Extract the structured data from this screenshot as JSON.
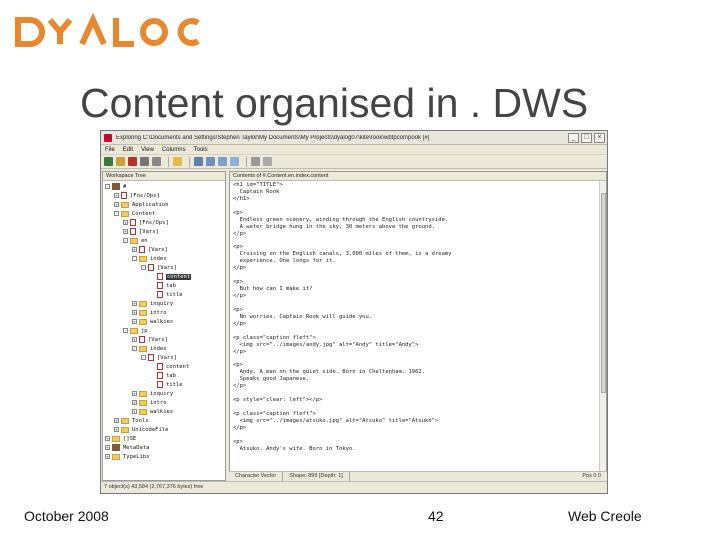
{
  "logo": {
    "text": "DYALOC",
    "color": "#e8872b"
  },
  "slide": {
    "title": "Content organised in . DWS"
  },
  "footer": {
    "date": "October 2008",
    "page": "42",
    "product": "Web Creole"
  },
  "window": {
    "title": "Exploring C:\\Documents and Settings\\Stephen Taylor\\My Documents\\My Projects\\dyalog07\\kite\\rook\\wbtpcon\\pook [#]",
    "menu": [
      "File",
      "Edit",
      "View",
      "Columns",
      "Tools"
    ],
    "left_pane_title": "Workspace Tree",
    "right_pane_title": "Contents of #.Content.en.index.content",
    "tree": [
      {
        "label": "#",
        "level": 0,
        "expand": "-",
        "icon": "ns"
      },
      {
        "label": "[Fns/Ops]",
        "level": 1,
        "expand": "+",
        "icon": "doc"
      },
      {
        "label": "Application",
        "level": 1,
        "expand": "+",
        "icon": "folder"
      },
      {
        "label": "Content",
        "level": 1,
        "expand": "-",
        "icon": "folder"
      },
      {
        "label": "[Fns/Ops]",
        "level": 2,
        "expand": "+",
        "icon": "doc"
      },
      {
        "label": "[Vars]",
        "level": 2,
        "expand": "+",
        "icon": "doc"
      },
      {
        "label": "en",
        "level": 2,
        "expand": "-",
        "icon": "folder"
      },
      {
        "label": "[Vars]",
        "level": 3,
        "expand": "+",
        "icon": "doc"
      },
      {
        "label": "index",
        "level": 3,
        "expand": "-",
        "icon": "folder"
      },
      {
        "label": "[Vars]",
        "level": 4,
        "expand": "-",
        "icon": "doc"
      },
      {
        "label": "content",
        "level": 5,
        "expand": "",
        "icon": "doc",
        "selected": true
      },
      {
        "label": "tab",
        "level": 5,
        "expand": "",
        "icon": "doc"
      },
      {
        "label": "title",
        "level": 5,
        "expand": "",
        "icon": "doc"
      },
      {
        "label": "inquiry",
        "level": 3,
        "expand": "+",
        "icon": "folder"
      },
      {
        "label": "intro",
        "level": 3,
        "expand": "+",
        "icon": "folder"
      },
      {
        "label": "walkies",
        "level": 3,
        "expand": "+",
        "icon": "folder"
      },
      {
        "label": "jp",
        "level": 2,
        "expand": "-",
        "icon": "folder"
      },
      {
        "label": "[Vars]",
        "level": 3,
        "expand": "+",
        "icon": "doc"
      },
      {
        "label": "index",
        "level": 3,
        "expand": "-",
        "icon": "folder"
      },
      {
        "label": "[Vars]",
        "level": 4,
        "expand": "-",
        "icon": "doc"
      },
      {
        "label": "content",
        "level": 5,
        "expand": "",
        "icon": "doc"
      },
      {
        "label": "tab",
        "level": 5,
        "expand": "",
        "icon": "doc"
      },
      {
        "label": "title",
        "level": 5,
        "expand": "",
        "icon": "doc"
      },
      {
        "label": "inquiry",
        "level": 3,
        "expand": "+",
        "icon": "folder"
      },
      {
        "label": "intro",
        "level": 3,
        "expand": "+",
        "icon": "folder"
      },
      {
        "label": "walkies",
        "level": 3,
        "expand": "+",
        "icon": "folder"
      },
      {
        "label": "Tools",
        "level": 1,
        "expand": "+",
        "icon": "folder"
      },
      {
        "label": "UnicodeFile",
        "level": 1,
        "expand": "+",
        "icon": "folder"
      },
      {
        "label": "[]SE",
        "level": 0,
        "expand": "+",
        "icon": "folder"
      },
      {
        "label": "MetaData",
        "level": 0,
        "expand": "+",
        "icon": "ns"
      },
      {
        "label": "TypeLibs",
        "level": 0,
        "expand": "+",
        "icon": "folder"
      }
    ],
    "code_lines": [
      "<h1 id=\"TITLE\">",
      "  Captain Rook",
      "</h1>",
      "",
      "<p>",
      "  Endless green scenery, winding through the English countryside.",
      "  A water bridge hung in the sky, 30 meters above the ground.",
      "</p>",
      "",
      "<p>",
      "  Cruising on the English canals, 3,000 miles of them, is a dreamy",
      "  experience. One longs for it.",
      "</p>",
      "",
      "<p>",
      "  But how can I make it?",
      "</p>",
      "",
      "<p>",
      "  No worries. Captain Rook will guide you.",
      "</p>",
      "",
      "<p class=\"caption fleft\">",
      "  <img src=\"../images/andy.jpg\" alt=\"Andy\" title=\"Andy\">",
      "</p>",
      "",
      "<p>",
      "  Andy. A man on the quiet side. Born in Cheltenham. 1962.",
      "  Speaks good Japanese.",
      "</p>",
      "",
      "<p style=\"clear: left\"></p>",
      "",
      "<p class=\"caption fleft\">",
      "  <img src=\"../images/atsuko.jpg\" alt=\"Atsuko\" title=\"Atsuko\">",
      "</p>",
      "",
      "<p>",
      "  Atsuko. Andy's wife. Born in Tokyo."
    ],
    "pane_status": {
      "kind": "Character Vector",
      "shape": "Shape: 899 [Depth: 1]",
      "pos": "Pos 0 0"
    },
    "status": "7 object(s) 43,584 (2,767,376 bytes) free"
  }
}
